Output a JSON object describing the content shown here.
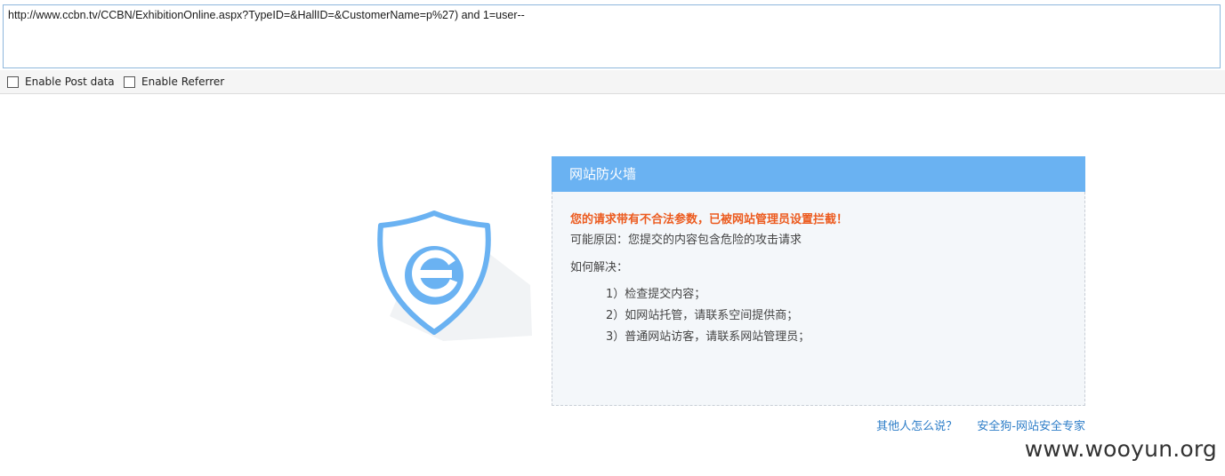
{
  "url_bar": {
    "value": "http://www.ccbn.tv/CCBN/ExhibitionOnline.aspx?TypeID=&HallID=&CustomerName=p%27) and 1=user--"
  },
  "options": {
    "post_data_label": "Enable Post data",
    "post_data_checked": false,
    "referrer_label": "Enable Referrer",
    "referrer_checked": false
  },
  "firewall": {
    "header_title": "网站防火墙",
    "warning": "您的请求带有不合法参数，已被网站管理员设置拦截！",
    "reason": "可能原因：您提交的内容包含危险的攻击请求",
    "solve_heading": "如何解决：",
    "steps": [
      "1）检查提交内容；",
      "2）如网站托管，请联系空间提供商；",
      "3）普通网站访客，请联系网站管理员；"
    ],
    "link_others": "其他人怎么说？",
    "link_brand": "安全狗-网站安全专家"
  },
  "logo": {
    "icon": "shield-e-icon",
    "shield_color": "#6ab2f2"
  },
  "watermark": "www.wooyun.org",
  "colors": {
    "header_bg": "#6ab2f2",
    "warning_text": "#ec5b1f",
    "link": "#2e7ec8",
    "panel_bg": "#f4f7fa"
  }
}
